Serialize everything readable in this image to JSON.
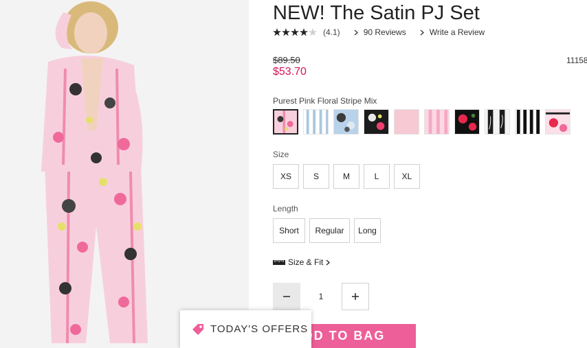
{
  "product": {
    "title": "NEW! The Satin PJ Set",
    "rating_text": "(4.1)",
    "rating_value": 4.1,
    "reviews_label": "90 Reviews",
    "write_review_label": "Write a Review",
    "old_price": "$89.50",
    "new_price": "$53.70",
    "sku": "11158",
    "color_name": "Purest Pink Floral Stripe Mix"
  },
  "colors": {
    "accent": "#d4145a",
    "button": "#ed5f99",
    "garment_pink": "#f7cfdc"
  },
  "swatches": [
    {
      "name": "Purest Pink Floral Stripe Mix",
      "selected": true
    },
    {
      "name": "Blue Stripe",
      "selected": false
    },
    {
      "name": "Blue Floral",
      "selected": false
    },
    {
      "name": "Black Floral",
      "selected": false
    },
    {
      "name": "Solid Pink",
      "selected": false
    },
    {
      "name": "Pink Stripe",
      "selected": false
    },
    {
      "name": "Black Rose",
      "selected": false
    },
    {
      "name": "Black Script",
      "selected": false
    },
    {
      "name": "Black White Stripe",
      "selected": false
    },
    {
      "name": "Pink Rose Stripe",
      "selected": false
    }
  ],
  "size": {
    "label": "Size",
    "options": [
      "XS",
      "S",
      "M",
      "L",
      "XL"
    ]
  },
  "length": {
    "label": "Length",
    "options": [
      "Short",
      "Regular",
      "Long"
    ]
  },
  "size_fit_label": "Size & Fit",
  "quantity": {
    "value": "1"
  },
  "add_to_bag_label": "DD TO BAG",
  "offers_label": "TODAY'S OFFERS"
}
